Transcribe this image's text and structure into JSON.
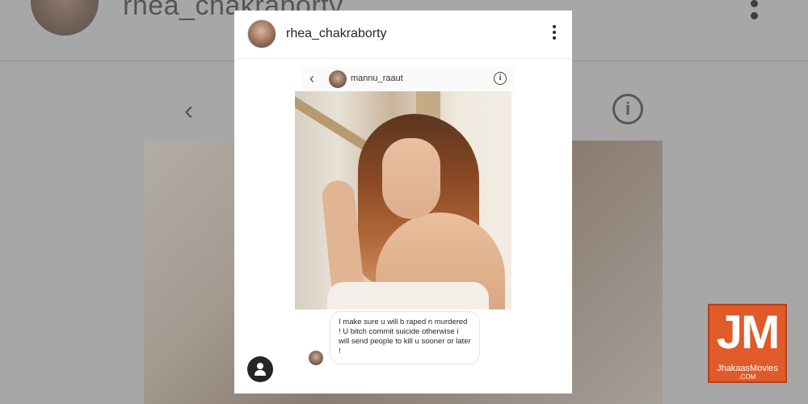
{
  "background": {
    "username": "rhea_chakraborty"
  },
  "post": {
    "username": "rhea_chakraborty",
    "more_options_icon": "more-vertical-icon"
  },
  "dm_screenshot": {
    "username": "mannu_raaut",
    "back_icon": "chevron-left-icon",
    "info_icon": "info-icon",
    "info_glyph": "i",
    "message": "I make sure u will b raped n murdered ! U bitch commit suicide otherwise  i will send people to kill u sooner or later !"
  },
  "watermark": {
    "letters": "JM",
    "brand": "JhakaasMovies",
    "domain": ".COM",
    "color": "#e05a2a"
  }
}
